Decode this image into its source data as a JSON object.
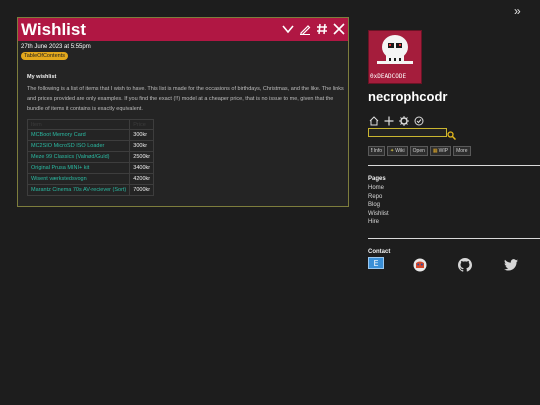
{
  "post": {
    "title": "Wishlist",
    "date": "27th June 2023 at 5:55pm",
    "tag": "TableOfContents",
    "heading": "My wishlist",
    "body": "The following is a list of items that I wish to have. This list is made for the occasions of birthdays, Christmas, and the like. The links and prices provided are only examples. If you find the exact (!!) model at a cheaper price, that is no issue to me, given that the bundle of items it contains is exactly equivalent.",
    "table": {
      "headers": [
        "Item",
        "Price"
      ],
      "rows": [
        {
          "item": "MCBoot Memory Card",
          "price": "300kr"
        },
        {
          "item": "MC2SIO MicroSD ISO Loader",
          "price": "300kr"
        },
        {
          "item": "Meze 99 Classics (Valnød/Guld)",
          "price": "2500kr"
        },
        {
          "item": "Original Prusa MINI+ kit",
          "price": "3400kr"
        },
        {
          "item": "Wisent værkstedsvogn",
          "price": "4200kr"
        },
        {
          "item": "Marantz Cinema 70s AV-reciever (Sort)",
          "price": "7000kr"
        }
      ]
    }
  },
  "sidebar": {
    "avatar_caption": "0xDEADCODE",
    "site_name": "necrophcodr",
    "search": {
      "value": "",
      "placeholder": ""
    },
    "badges": [
      {
        "icon": "info-icon",
        "label": "Info"
      },
      {
        "icon": "wiki-icon",
        "label": "Wiki"
      },
      {
        "icon": "open-icon",
        "label": "Open"
      },
      {
        "icon": "wip-icon",
        "label": "WIP"
      },
      {
        "icon": "more-icon",
        "label": "More"
      }
    ],
    "pages_title": "Pages",
    "pages": [
      "Home",
      "Repo",
      "Blog",
      "Wishlist",
      "Hire"
    ],
    "contact_title": "Contact"
  },
  "colors": {
    "header": "#b01743",
    "link": "#2bbba3",
    "tag": "#e3a81c",
    "search_border": "#c9b530"
  }
}
